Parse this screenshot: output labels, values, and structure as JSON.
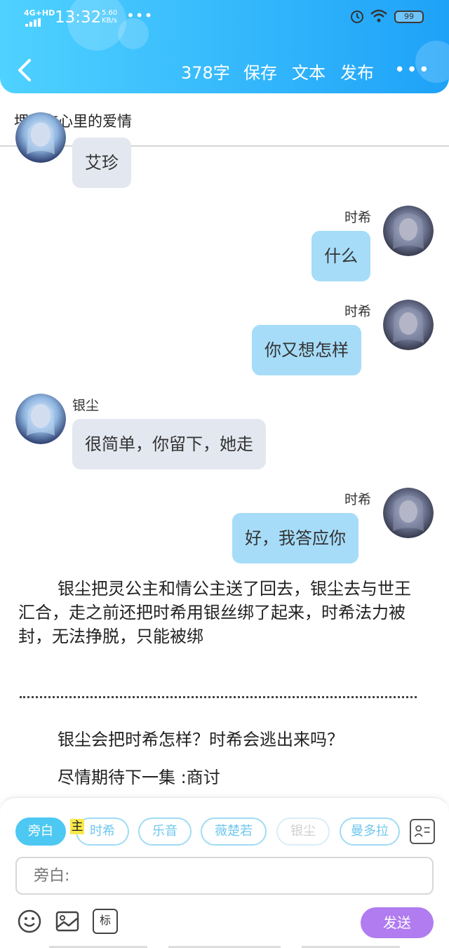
{
  "status": {
    "network": "4G+HD",
    "time": "13:32",
    "speed_value": "5.60",
    "speed_unit": "KB/s",
    "more": "•••",
    "battery": "99"
  },
  "nav": {
    "word_count": "378字",
    "save": "保存",
    "text": "文本",
    "publish": "发布",
    "more": "•••"
  },
  "doc_title": "埋藏在心里的爱情",
  "messages": [
    {
      "side": "left",
      "speaker": "",
      "text": "艾珍"
    },
    {
      "side": "right",
      "speaker": "时希",
      "text": "什么"
    },
    {
      "side": "right",
      "speaker": "时希",
      "text": "你又想怎样"
    },
    {
      "side": "left",
      "speaker": "银尘",
      "text": "很简单，你留下，她走"
    },
    {
      "side": "right",
      "speaker": "时希",
      "text": "好，我答应你"
    }
  ],
  "narration": "银尘把灵公主和情公主送了回去，银尘去与世王汇合，走之前还把时希用银丝绑了起来，时希法力被封，无法挣脱，只能被绑",
  "closing": [
    "银尘会把时希怎样？时希会逃出来吗？",
    "尽情期待下一集 :商讨"
  ],
  "panel": {
    "roles": [
      "旁白",
      "时希",
      "乐音",
      "薇楚若",
      "银尘",
      "曼多拉"
    ],
    "main_badge": "主",
    "input_placeholder": "旁白:",
    "tag_label": "标",
    "send": "发送"
  },
  "colors": {
    "header_start": "#4fd2ff",
    "header_end": "#1ea2f8",
    "bubble_left": "#e3e7ef",
    "bubble_right": "#a6dcf8",
    "send_button": "#b07cf0",
    "chip_active": "#4dc8f2"
  }
}
